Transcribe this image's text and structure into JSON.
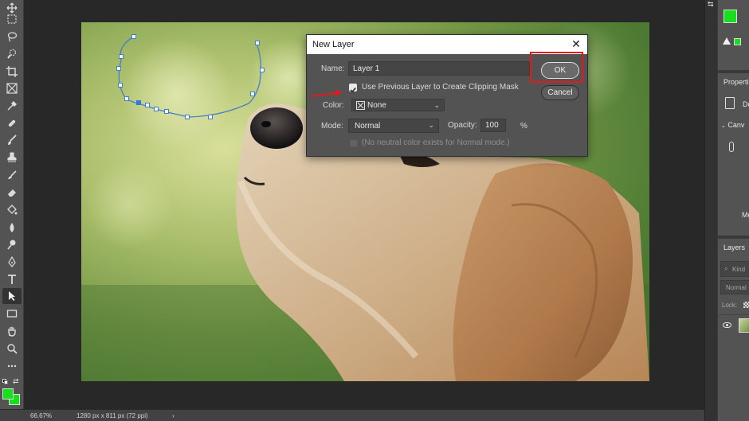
{
  "dialog": {
    "title": "New Layer",
    "close_glyph": "✕",
    "name_label": "Name:",
    "name_value": "Layer 1",
    "clip_label": "Use Previous Layer to Create Clipping Mask",
    "clip_checked": true,
    "color_label": "Color:",
    "color_value": "None",
    "mode_label": "Mode:",
    "mode_value": "Normal",
    "opacity_label": "Opacity:",
    "opacity_value": "100",
    "opacity_unit": "%",
    "neutral_label": "(No neutral color exists for Normal mode.)",
    "ok_label": "OK",
    "cancel_label": "Cancel"
  },
  "status_bar": {
    "zoom": "66.67%",
    "doc_info": "1280 px x 811 px (72 ppi)",
    "arrow": "›"
  },
  "right_panel": {
    "properties_title": "Properti",
    "doc_abbrev": "Do",
    "canvas_title": "Canv",
    "mo_abbrev": "Mo",
    "layers_title": "Layers",
    "kind_placeholder": "Kind",
    "blend_mode": "Normal",
    "lock_label": "Lock:"
  },
  "colors": {
    "foreground": "#16e01c",
    "background": "#16e01c",
    "highlight": "#e11b1b",
    "accent_blue": "#2f7de1"
  },
  "tools": [
    "move-tool",
    "marquee-tool",
    "lasso-tool",
    "quick-selection-tool",
    "crop-tool",
    "frame-tool",
    "eyedropper-tool",
    "healing-brush-tool",
    "brush-tool",
    "clone-stamp-tool",
    "history-brush-tool",
    "eraser-tool",
    "gradient-tool",
    "blur-tool",
    "dodge-tool",
    "pen-tool",
    "type-tool",
    "path-selection-tool",
    "rectangle-tool",
    "hand-tool",
    "zoom-tool",
    "more-tools"
  ]
}
